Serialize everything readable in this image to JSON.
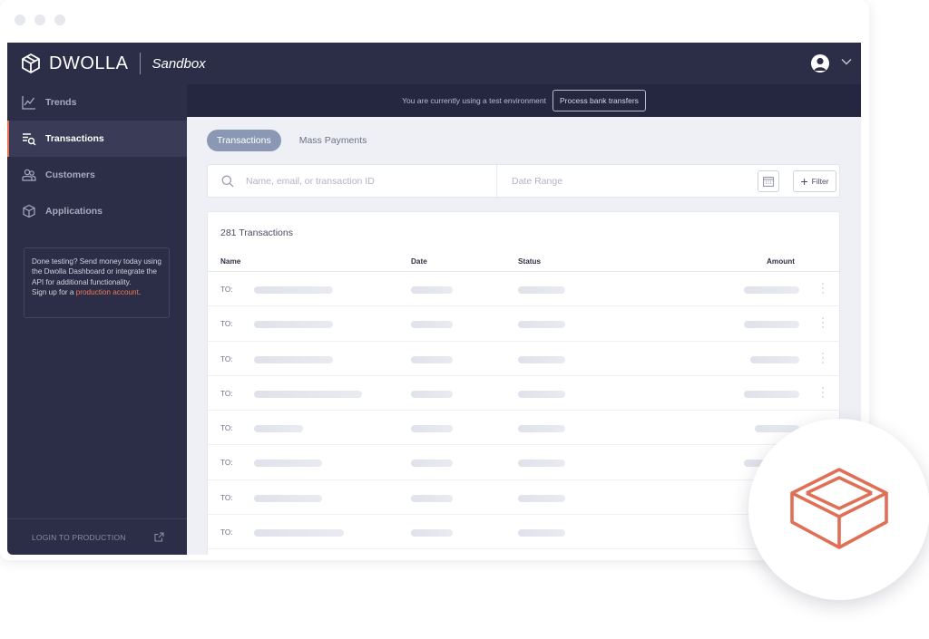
{
  "header": {
    "brand": "DWOLLA",
    "environment": "Sandbox",
    "accent_color": "#e8704e"
  },
  "sidebar": {
    "items": [
      {
        "label": "Trends",
        "icon": "trends-icon"
      },
      {
        "label": "Transactions",
        "icon": "transactions-icon",
        "active": true
      },
      {
        "label": "Customers",
        "icon": "customers-icon"
      },
      {
        "label": "Applications",
        "icon": "applications-icon"
      }
    ],
    "notice": {
      "text": "Done testing? Send money today using the Dwolla Dashboard or integrate the API for additional functionality.",
      "signup_prefix": "Sign up for a ",
      "link": "production account",
      "suffix": "."
    },
    "footer_label": "LOGIN TO PRODUCTION"
  },
  "banner": {
    "text": "You are currently using a test environment",
    "button": "Process bank transfers"
  },
  "main": {
    "tabs": [
      {
        "label": "Transactions",
        "active": true
      },
      {
        "label": "Mass Payments",
        "active": false
      }
    ],
    "search": {
      "placeholder": "Name, email, or transaction ID",
      "date_placeholder": "Date Range",
      "filter_label": "Filter"
    },
    "table": {
      "count_label": "281 Transactions",
      "columns": [
        "Name",
        "Date",
        "Status",
        "Amount"
      ],
      "row_prefix": "TO:",
      "rows": [
        {
          "to": "TO:"
        },
        {
          "to": "TO:"
        },
        {
          "to": "TO:"
        },
        {
          "to": "TO:"
        },
        {
          "to": "TO:"
        },
        {
          "to": "TO:"
        },
        {
          "to": "TO:"
        },
        {
          "to": "TO:"
        }
      ]
    }
  }
}
